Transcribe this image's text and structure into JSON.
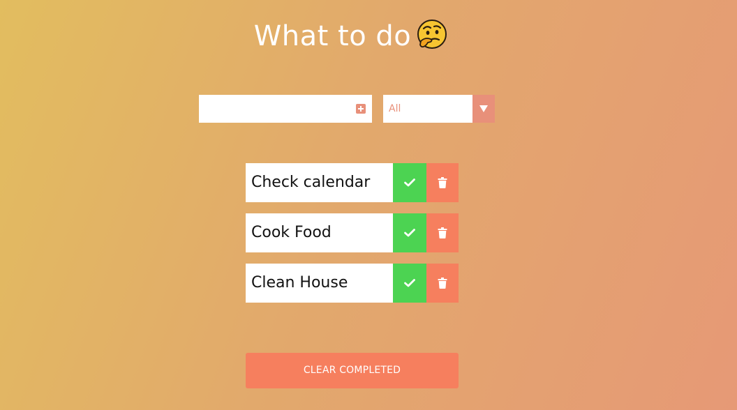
{
  "header": {
    "title": "What to do",
    "emoji_icon": "thinking-face-icon"
  },
  "add_todo": {
    "input_value": "",
    "input_placeholder": "",
    "add_icon": "plus-square-icon"
  },
  "filter": {
    "selected": "All"
  },
  "todos": [
    {
      "text": "Check calendar"
    },
    {
      "text": "Cook Food"
    },
    {
      "text": "Clean House"
    }
  ],
  "item_actions": {
    "complete_icon": "check-icon",
    "delete_icon": "trash-icon"
  },
  "clear_button": {
    "label": "CLEAR COMPLETED"
  },
  "colors": {
    "accent": "#f67f5e",
    "complete": "#4cd352",
    "select_accent": "#e8907a"
  }
}
